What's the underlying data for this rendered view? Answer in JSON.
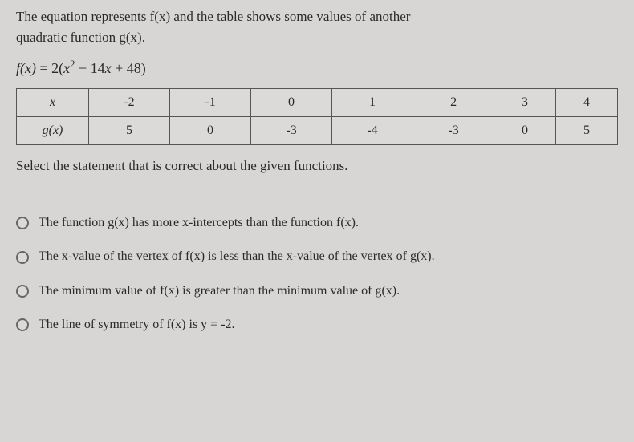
{
  "intro_line1": "The equation represents f(x) and the table shows some values of another",
  "intro_line2": "quadratic function g(x).",
  "equation": {
    "lhs": "f(x)",
    "eq": "=",
    "rhs_prefix": "2(",
    "rhs_var": "x",
    "rhs_exp": "2",
    "rhs_mid": " − 14",
    "rhs_var2": "x",
    "rhs_suffix": " + 48)"
  },
  "table": {
    "row1_label": "x",
    "row2_label": "g(x)",
    "headers": [
      "-2",
      "-1",
      "0",
      "1",
      "2",
      "3",
      "4"
    ],
    "values": [
      "5",
      "0",
      "-3",
      "-4",
      "-3",
      "0",
      "5"
    ]
  },
  "chart_data": {
    "type": "table",
    "title": "Values of g(x)",
    "x": [
      -2,
      -1,
      0,
      1,
      2,
      3,
      4
    ],
    "g_of_x": [
      5,
      0,
      -3,
      -4,
      -3,
      0,
      5
    ],
    "f_of_x_formula": "2*(x^2 - 14*x + 48)"
  },
  "prompt": "Select the statement that is correct about the given functions.",
  "options": {
    "a": "The function g(x) has more x-intercepts than the function f(x).",
    "b": "The x-value of the vertex of f(x) is less than the x-value of the vertex of g(x).",
    "c": "The minimum value of f(x) is greater than the minimum value of g(x).",
    "d": "The line of symmetry of f(x) is y = -2."
  }
}
